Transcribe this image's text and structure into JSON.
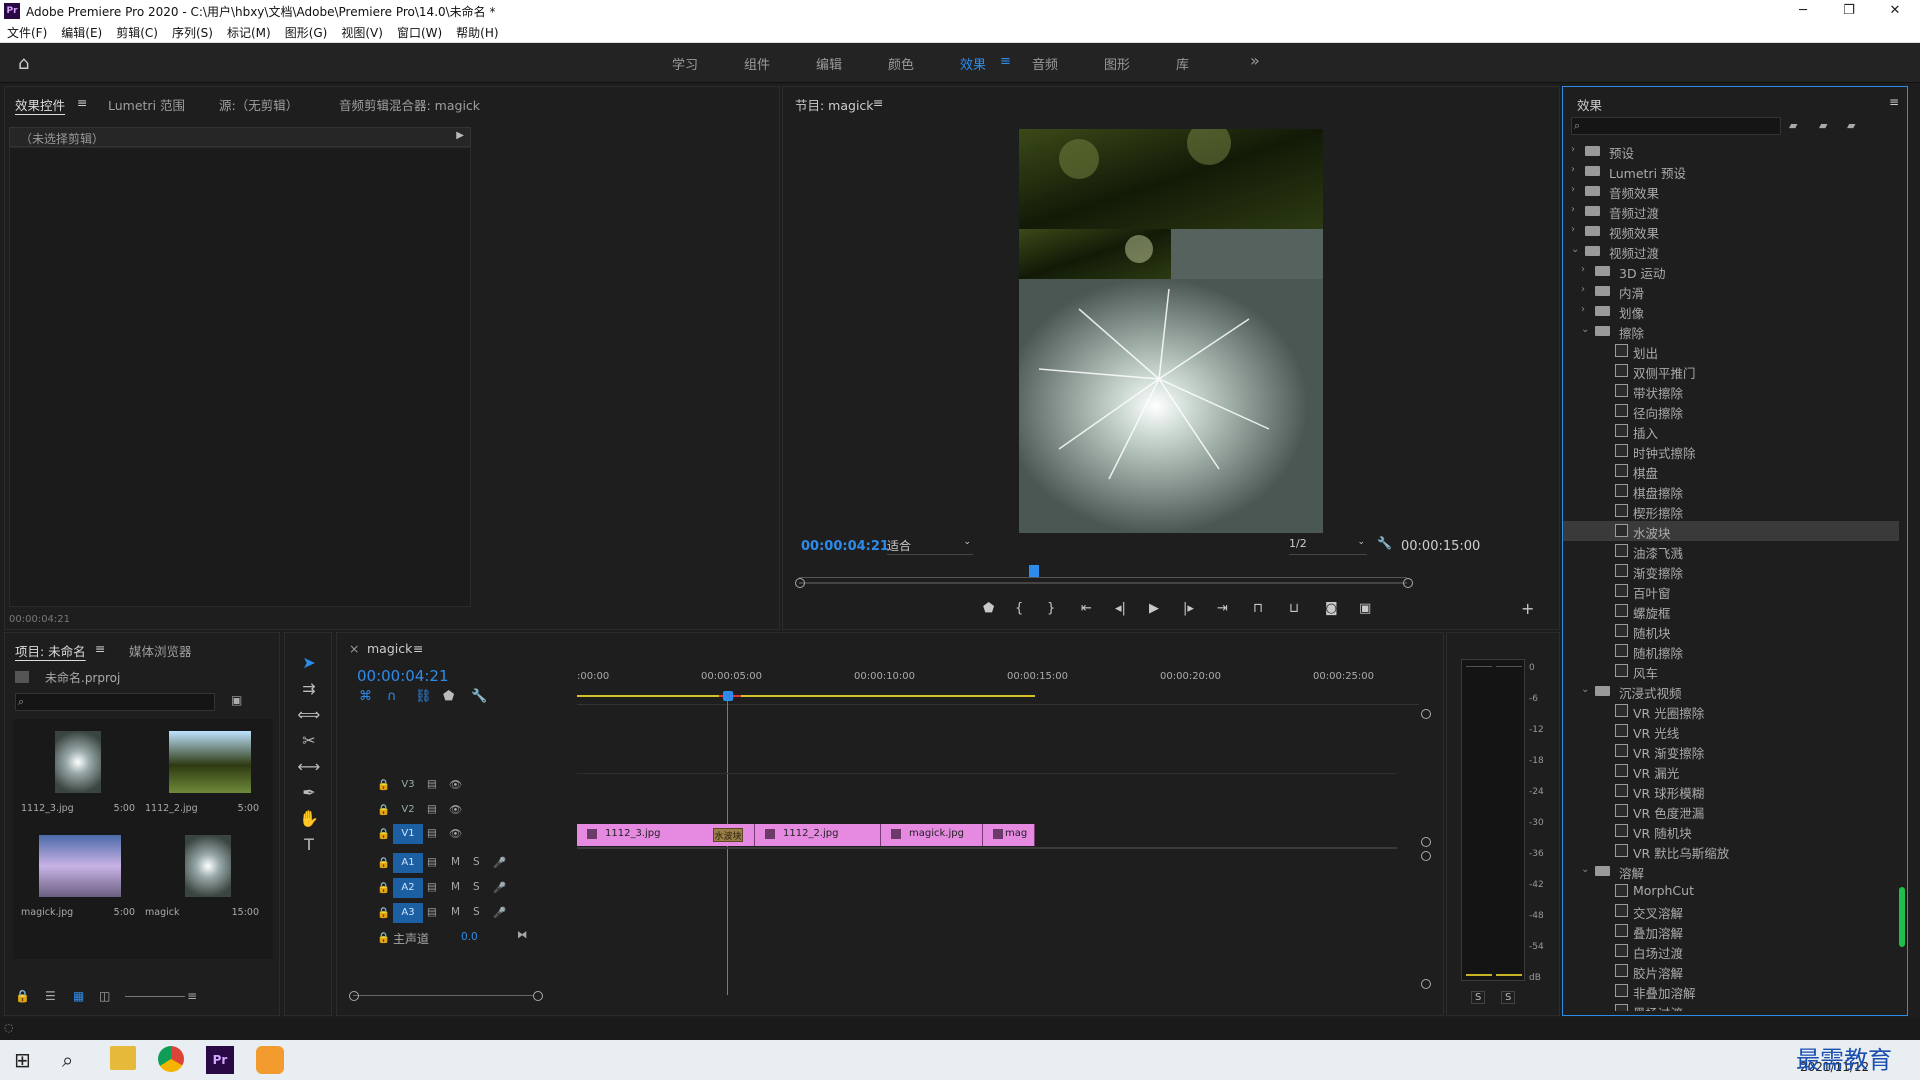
{
  "titlebar": {
    "app_title": "Adobe Premiere Pro 2020 - C:\\用户\\hbxy\\文档\\Adobe\\Premiere Pro\\14.0\\未命名 *",
    "min": "─",
    "max": "❐",
    "close": "✕"
  },
  "menu": [
    "文件(F)",
    "编辑(E)",
    "剪辑(C)",
    "序列(S)",
    "标记(M)",
    "图形(G)",
    "视图(V)",
    "窗口(W)",
    "帮助(H)"
  ],
  "workspaces": [
    "学习",
    "组件",
    "编辑",
    "颜色",
    "效果",
    "音频",
    "图形",
    "库"
  ],
  "workspace_active": "效果",
  "workspace_more": "»",
  "source_panel": {
    "tabs": [
      "效果控件",
      "Lumetri 范围",
      "源:（无剪辑）",
      "音频剪辑混合器: magick"
    ],
    "no_clip": "（未选择剪辑）",
    "timecode": "00:00:04:21"
  },
  "program_panel": {
    "title": "节目: magick",
    "timecode": "00:00:04:21",
    "fit": "适合",
    "res": "1/2",
    "duration": "00:00:15:00"
  },
  "effects_panel": {
    "title": "效果",
    "search_placeholder": "",
    "tree": [
      {
        "label": "预设",
        "level": 0,
        "type": "folder",
        "open": false
      },
      {
        "label": "Lumetri 预设",
        "level": 0,
        "type": "folder",
        "open": false
      },
      {
        "label": "音频效果",
        "level": 0,
        "type": "folder",
        "open": false
      },
      {
        "label": "音频过渡",
        "level": 0,
        "type": "folder",
        "open": false
      },
      {
        "label": "视频效果",
        "level": 0,
        "type": "folder",
        "open": false
      },
      {
        "label": "视频过渡",
        "level": 0,
        "type": "folder",
        "open": true
      },
      {
        "label": "3D 运动",
        "level": 1,
        "type": "folder",
        "open": false
      },
      {
        "label": "内滑",
        "level": 1,
        "type": "folder",
        "open": false
      },
      {
        "label": "划像",
        "level": 1,
        "type": "folder",
        "open": false
      },
      {
        "label": "擦除",
        "level": 1,
        "type": "folder",
        "open": true
      },
      {
        "label": "划出",
        "level": 2,
        "type": "fx"
      },
      {
        "label": "双侧平推门",
        "level": 2,
        "type": "fx"
      },
      {
        "label": "带状擦除",
        "level": 2,
        "type": "fx"
      },
      {
        "label": "径向擦除",
        "level": 2,
        "type": "fx"
      },
      {
        "label": "插入",
        "level": 2,
        "type": "fx"
      },
      {
        "label": "时钟式擦除",
        "level": 2,
        "type": "fx"
      },
      {
        "label": "棋盘",
        "level": 2,
        "type": "fx"
      },
      {
        "label": "棋盘擦除",
        "level": 2,
        "type": "fx"
      },
      {
        "label": "楔形擦除",
        "level": 2,
        "type": "fx"
      },
      {
        "label": "水波块",
        "level": 2,
        "type": "fx",
        "selected": true
      },
      {
        "label": "油漆飞溅",
        "level": 2,
        "type": "fx"
      },
      {
        "label": "渐变擦除",
        "level": 2,
        "type": "fx"
      },
      {
        "label": "百叶窗",
        "level": 2,
        "type": "fx"
      },
      {
        "label": "螺旋框",
        "level": 2,
        "type": "fx"
      },
      {
        "label": "随机块",
        "level": 2,
        "type": "fx"
      },
      {
        "label": "随机擦除",
        "level": 2,
        "type": "fx"
      },
      {
        "label": "风车",
        "level": 2,
        "type": "fx"
      },
      {
        "label": "沉浸式视频",
        "level": 1,
        "type": "folder",
        "open": true
      },
      {
        "label": "VR 光圈擦除",
        "level": 2,
        "type": "fx"
      },
      {
        "label": "VR 光线",
        "level": 2,
        "type": "fx"
      },
      {
        "label": "VR 渐变擦除",
        "level": 2,
        "type": "fx"
      },
      {
        "label": "VR 漏光",
        "level": 2,
        "type": "fx"
      },
      {
        "label": "VR 球形模糊",
        "level": 2,
        "type": "fx"
      },
      {
        "label": "VR 色度泄漏",
        "level": 2,
        "type": "fx"
      },
      {
        "label": "VR 随机块",
        "level": 2,
        "type": "fx"
      },
      {
        "label": "VR 默比乌斯缩放",
        "level": 2,
        "type": "fx"
      },
      {
        "label": "溶解",
        "level": 1,
        "type": "folder",
        "open": true
      },
      {
        "label": "MorphCut",
        "level": 2,
        "type": "fx"
      },
      {
        "label": "交叉溶解",
        "level": 2,
        "type": "fx"
      },
      {
        "label": "叠加溶解",
        "level": 2,
        "type": "fx"
      },
      {
        "label": "白场过渡",
        "level": 2,
        "type": "fx"
      },
      {
        "label": "胶片溶解",
        "level": 2,
        "type": "fx"
      },
      {
        "label": "非叠加溶解",
        "level": 2,
        "type": "fx"
      },
      {
        "label": "黑场过渡",
        "level": 2,
        "type": "fx"
      }
    ]
  },
  "project_panel": {
    "tabs": [
      "项目: 未命名",
      "媒体浏览器"
    ],
    "file": "未命名.prproj",
    "items": [
      {
        "name": "1112_3.jpg",
        "dur": "5:00"
      },
      {
        "name": "1112_2.jpg",
        "dur": "5:00"
      },
      {
        "name": "magick.jpg",
        "dur": "5:00"
      },
      {
        "name": "magick",
        "dur": "15:00"
      }
    ]
  },
  "timeline": {
    "tab": "magick",
    "timecode": "00:00:04:21",
    "ruler": [
      ":00:00",
      "00:00:05:00",
      "00:00:10:00",
      "00:00:15:00",
      "00:00:20:00",
      "00:00:25:00"
    ],
    "video_tracks": [
      "V3",
      "V2",
      "V1"
    ],
    "audio_tracks": [
      "A1",
      "A2",
      "A3"
    ],
    "master": "主声道",
    "master_val": "0.0",
    "clips": [
      "1112_3.jpg",
      "1112_2.jpg",
      "magick.jpg",
      "mag"
    ],
    "transition_label": "水波块",
    "m": "M",
    "s": "S"
  },
  "meter": {
    "scale": [
      "0",
      "-6",
      "-12",
      "-18",
      "-24",
      "-30",
      "-36",
      "-42",
      "-48",
      "-54",
      "dB"
    ],
    "s1": "S",
    "s2": "S"
  },
  "taskbar": {
    "date": "2021/11/12",
    "watermark": "最需教育"
  },
  "colors": {
    "accent": "#2d8ceb",
    "clip": "#e58ae0",
    "bg": "#1d1d1d"
  }
}
